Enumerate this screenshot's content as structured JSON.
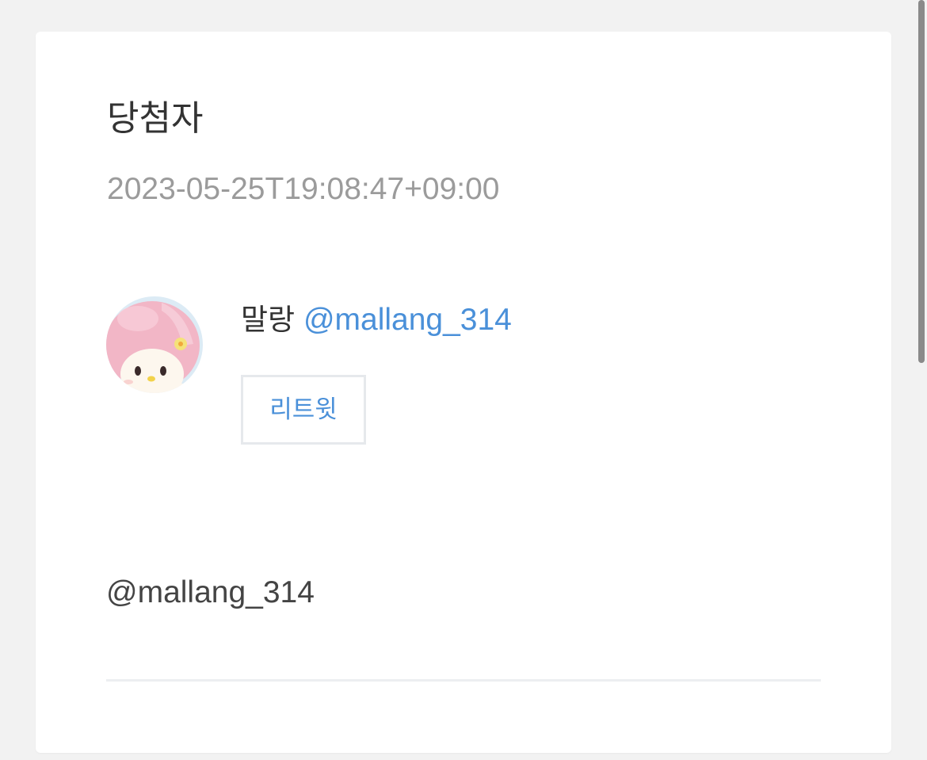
{
  "card": {
    "title": "당첨자",
    "timestamp": "2023-05-25T19:08:47+09:00"
  },
  "winner": {
    "avatar_icon": "avatar-my-melody-icon",
    "name": "말랑",
    "handle": "@mallang_314",
    "retweet_label": "리트윗"
  },
  "comment": {
    "text": "@mallang_314"
  },
  "colors": {
    "background": "#f2f2f2",
    "card": "#ffffff",
    "link": "#4a90d9",
    "muted": "#9b9b9b",
    "text": "#333333"
  }
}
